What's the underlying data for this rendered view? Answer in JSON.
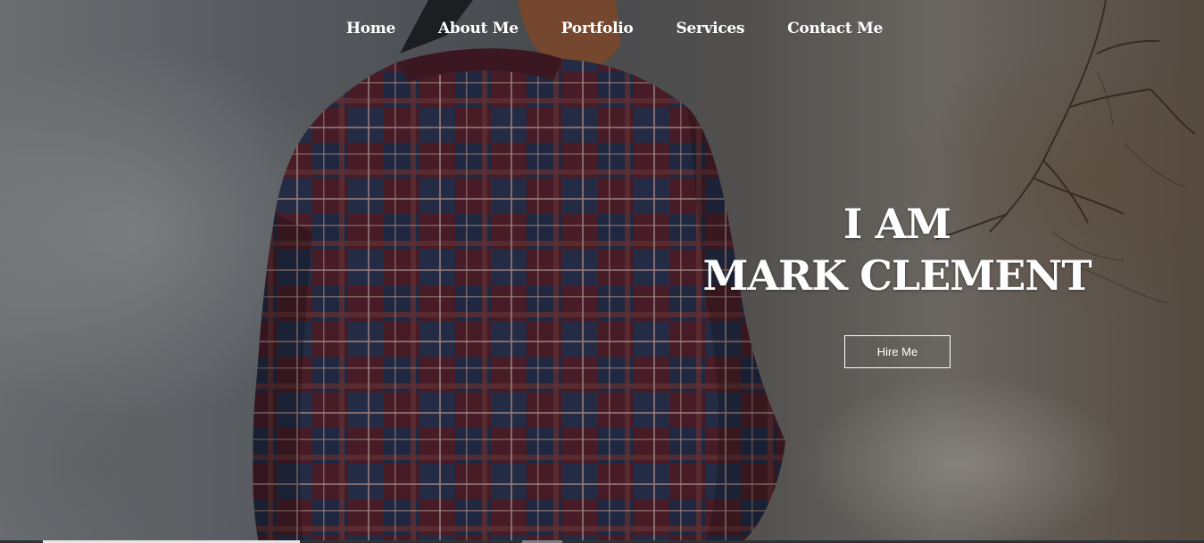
{
  "nav": {
    "items": [
      {
        "label": "Home"
      },
      {
        "label": "About Me"
      },
      {
        "label": "Portfolio"
      },
      {
        "label": "Services"
      },
      {
        "label": "Contact Me"
      }
    ]
  },
  "hero": {
    "headline_line1": "I AM",
    "headline_line2": "MARK CLEMENT",
    "cta_label": "Hire Me",
    "background_description_icon": "photo-man-plaid-shirt-outdoors"
  },
  "colors": {
    "text": "#ffffff",
    "button_border": "#ffffff"
  }
}
